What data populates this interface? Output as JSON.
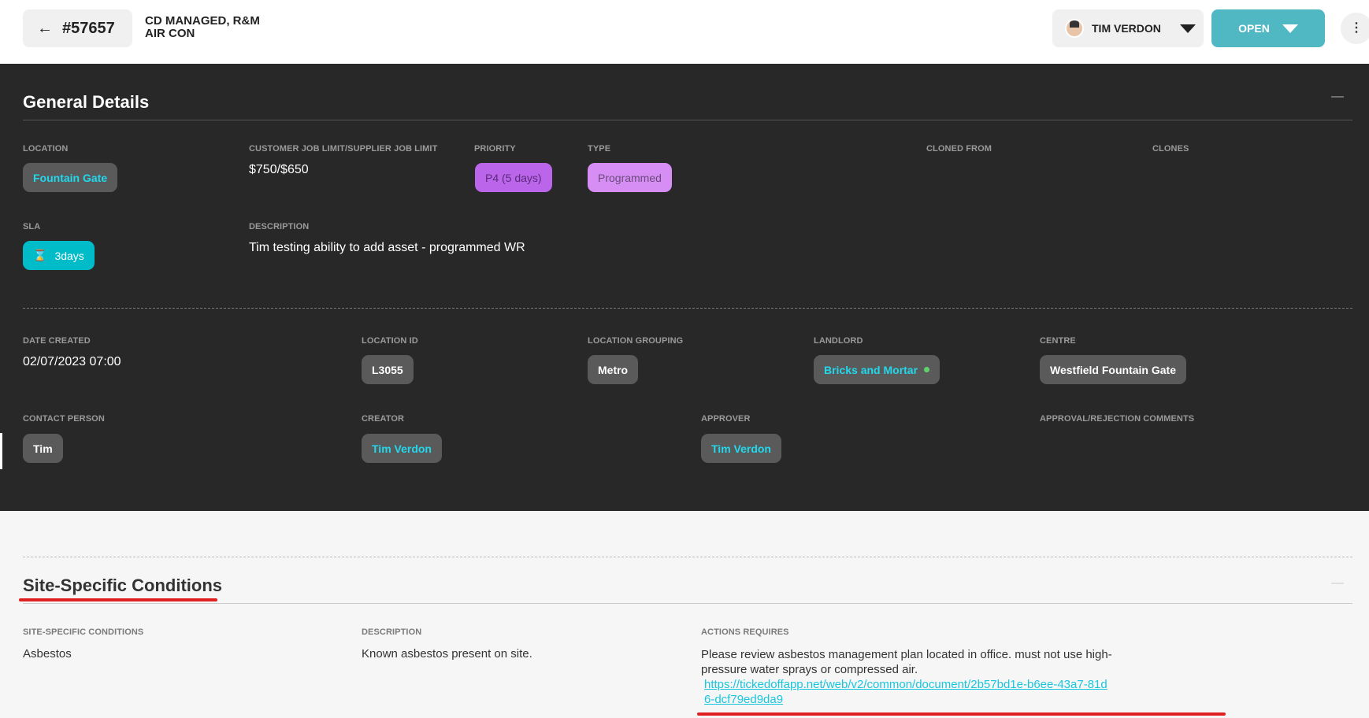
{
  "header": {
    "job_number": "#57657",
    "title_line1": "CD MANAGED, R&M",
    "title_line2": "AIR CON",
    "user": "TIM VERDON",
    "status": "OPEN",
    "more": "⋮"
  },
  "general": {
    "title": "General Details",
    "collapse": "—",
    "location": {
      "label": "LOCATION",
      "value": "Fountain Gate"
    },
    "job_limit": {
      "label": "CUSTOMER JOB LIMIT/SUPPLIER JOB LIMIT",
      "value": "$750/$650"
    },
    "priority": {
      "label": "PRIORITY",
      "value": "P4 (5 days)"
    },
    "type": {
      "label": "TYPE",
      "value": "Programmed"
    },
    "cloned_from": {
      "label": "CLONED FROM"
    },
    "clones": {
      "label": "CLONES"
    },
    "sla": {
      "label": "SLA",
      "value": "3days",
      "icon": "hourglass-icon"
    },
    "description": {
      "label": "DESCRIPTION",
      "value": "Tim testing ability to add asset - programmed WR"
    },
    "date_created": {
      "label": "DATE CREATED",
      "value": "02/07/2023 07:00"
    },
    "location_id": {
      "label": "LOCATION ID",
      "value": "L3055"
    },
    "location_grouping": {
      "label": "LOCATION GROUPING",
      "value": "Metro"
    },
    "landlord": {
      "label": "LANDLORD",
      "value": "Bricks and Mortar"
    },
    "centre": {
      "label": "CENTRE",
      "value": "Westfield Fountain Gate"
    },
    "contact_person": {
      "label": "CONTACT PERSON",
      "value": "Tim"
    },
    "creator": {
      "label": "CREATOR",
      "value": "Tim Verdon"
    },
    "approver": {
      "label": "APPROVER",
      "value": "Tim Verdon"
    },
    "approval_comments": {
      "label": "APPROVAL/REJECTION COMMENTS"
    }
  },
  "site": {
    "title": "Site-Specific Conditions",
    "collapse": "—",
    "conditions": {
      "label": "SITE-SPECIFIC CONDITIONS",
      "value": "Asbestos"
    },
    "description": {
      "label": "DESCRIPTION",
      "value": "Known asbestos present on site."
    },
    "actions": {
      "label": "ACTIONS REQUIRES",
      "value": "Please review asbestos management plan located in office. must not use high-pressure water sprays or compressed air.",
      "link": "https://tickedoffapp.net/web/v2/common/document/2b57bd1e-b6ee-43a7-81d6-dcf79ed9da9"
    }
  },
  "colors": {
    "accent": "#50b8c3",
    "cyan_text": "#22d8ec",
    "priority": "#bb66ea",
    "type": "#d68ef5",
    "sla": "#00bcc8",
    "annotation_red": "#e02020"
  }
}
